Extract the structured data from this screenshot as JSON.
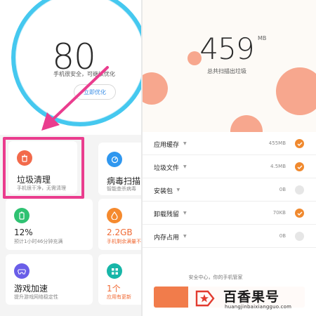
{
  "left": {
    "score": "80",
    "score_subtitle": "手机很安全，可继续优化",
    "optimize_button": "立即优化",
    "tiles": {
      "junk": {
        "title": "垃圾清理",
        "subtitle": "手机很干净，无需清理",
        "icon": "trash-icon"
      },
      "virus": {
        "title": "病毒扫描",
        "subtitle": "智能查杀病毒",
        "icon": "shield-scan-icon"
      },
      "battery": {
        "title": "12%",
        "subtitle": "预计1小时46分钟充满",
        "icon": "battery-icon"
      },
      "storage": {
        "title": "2.2GB",
        "subtitle": "手机剩余满量不",
        "icon": "storage-icon"
      },
      "game": {
        "title": "游戏加速",
        "subtitle": "提升游戏网络稳定性",
        "icon": "gamepad-icon"
      },
      "apps": {
        "title": "1个",
        "subtitle": "应用有更新",
        "icon": "apps-grid-icon"
      }
    }
  },
  "right": {
    "total": "459",
    "total_unit": "MB",
    "total_subtitle": "总共扫描出垃圾",
    "items": [
      {
        "name": "应用缓存",
        "size": "455MB",
        "checked": true
      },
      {
        "name": "垃圾文件",
        "size": "4.5MB",
        "checked": true
      },
      {
        "name": "安装包",
        "size": "0B",
        "checked": false
      },
      {
        "name": "卸载残留",
        "size": "70KB",
        "checked": true
      },
      {
        "name": "内存占用",
        "size": "0B",
        "checked": false
      }
    ],
    "footer_note": "安全中心，你的手机管家"
  },
  "watermark": {
    "title": "百香果号",
    "url": "huangjinbaixiangguo.com"
  },
  "colors": {
    "ring": "#45c8ef",
    "highlight": "#ea3d8e",
    "accent_orange": "#f0892e",
    "button_orange": "#f17c4b",
    "blob": "#f7a78e"
  }
}
